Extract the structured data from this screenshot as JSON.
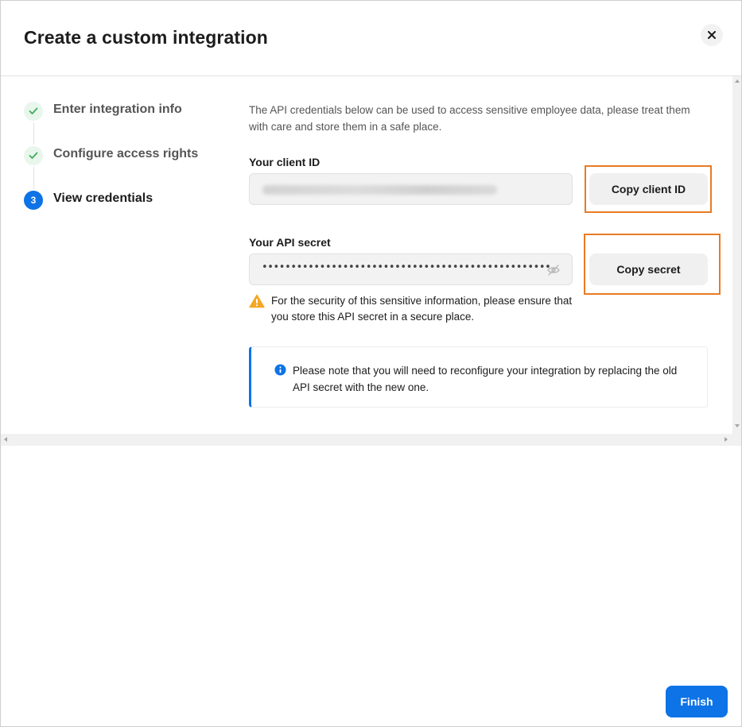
{
  "dialog": {
    "title": "Create a custom integration",
    "close_icon": "close-icon"
  },
  "steps": [
    {
      "label": "Enter integration info",
      "status": "done",
      "icon": "check-icon"
    },
    {
      "label": "Configure access rights",
      "status": "done",
      "icon": "check-icon"
    },
    {
      "label": "View credentials",
      "status": "active",
      "number": "3"
    }
  ],
  "content": {
    "intro": "The API credentials below can be used to access sensitive employee data, please treat them with care and store them in a safe place.",
    "client_id": {
      "label": "Your client ID",
      "button_label": "Copy client ID"
    },
    "api_secret": {
      "label": "Your API secret",
      "masked_value": "••••••••••••••••••••••••••••••••••••••••••••••••••",
      "visibility_icon": "eye-off-icon",
      "button_label": "Copy secret"
    },
    "warning": {
      "icon": "warning-icon",
      "text": "For the security of this sensitive information, please ensure that you store this API secret in a secure place."
    },
    "info": {
      "icon": "info-icon",
      "text": "Please note that you will need to reconfigure your integration by replacing the old API secret with the new one."
    }
  },
  "footer": {
    "finish_label": "Finish"
  },
  "colors": {
    "primary": "#0d73e6",
    "highlight": "#e87b24",
    "success": "#3fae5a",
    "warning": "#f5a623"
  }
}
